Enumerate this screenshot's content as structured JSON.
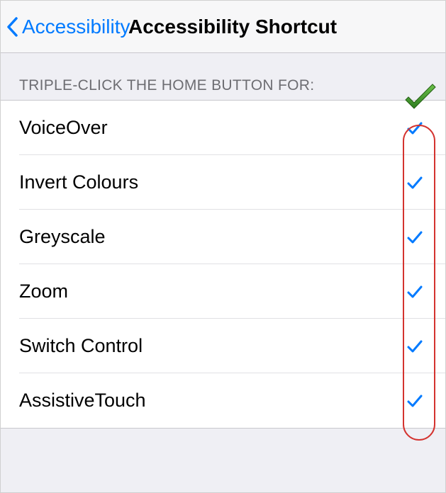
{
  "navbar": {
    "back_label": "Accessibility",
    "title": "Accessibility Shortcut"
  },
  "section": {
    "header": "TRIPLE-CLICK THE HOME BUTTON FOR:"
  },
  "options": [
    {
      "label": "VoiceOver",
      "checked": true
    },
    {
      "label": "Invert Colours",
      "checked": true
    },
    {
      "label": "Greyscale",
      "checked": true
    },
    {
      "label": "Zoom",
      "checked": true
    },
    {
      "label": "Switch Control",
      "checked": true
    },
    {
      "label": "AssistiveTouch",
      "checked": true
    }
  ],
  "colors": {
    "accent": "#007aff",
    "annot_green": "#3fa421",
    "annot_red": "#d4332f"
  }
}
